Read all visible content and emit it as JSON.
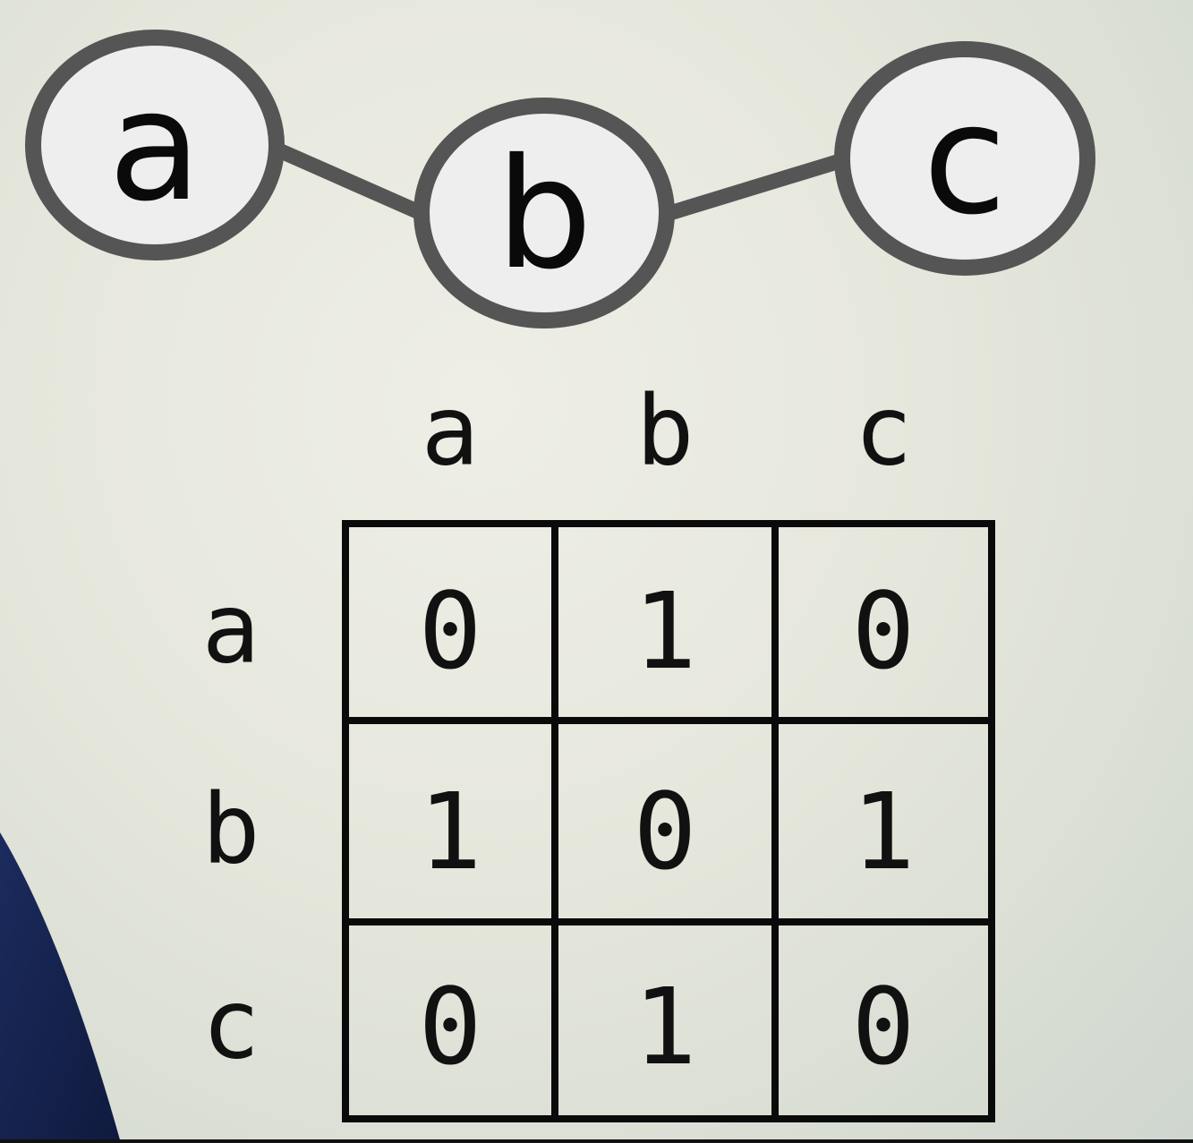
{
  "graph": {
    "nodes": [
      {
        "id": "a",
        "label": "a"
      },
      {
        "id": "b",
        "label": "b"
      },
      {
        "id": "c",
        "label": "c"
      }
    ],
    "edges": [
      {
        "from": "a",
        "to": "b"
      },
      {
        "from": "b",
        "to": "c"
      }
    ],
    "colors": {
      "node_fill": "#eeeeee",
      "node_stroke": "#555555",
      "edge": "#555555",
      "text": "#0a0a0a"
    }
  },
  "matrix": {
    "column_headers": [
      "a",
      "b",
      "c"
    ],
    "row_headers": [
      "a",
      "b",
      "c"
    ],
    "rows": [
      [
        "0",
        "1",
        "0"
      ],
      [
        "1",
        "0",
        "1"
      ],
      [
        "0",
        "1",
        "0"
      ]
    ]
  },
  "decoration": {
    "figure_color": "#1a2a5a"
  }
}
